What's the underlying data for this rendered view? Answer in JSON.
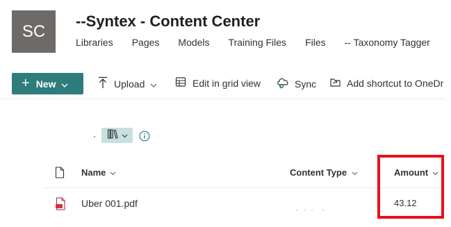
{
  "site": {
    "logo_initials": "SC",
    "title": "--Syntex - Content Center",
    "nav": [
      "Libraries",
      "Pages",
      "Models",
      "Training Files",
      "Files",
      "-- Taxonomy Tagger"
    ]
  },
  "commandbar": {
    "new_label": "New",
    "upload_label": "Upload",
    "grid_label": "Edit in grid view",
    "sync_label": "Sync",
    "shortcut_label": "Add shortcut to OneDr"
  },
  "list": {
    "columns": {
      "name": "Name",
      "content_type": "Content Type",
      "amount": "Amount"
    },
    "rows": [
      {
        "name": "Uber 001.pdf",
        "amount": "43.12"
      }
    ]
  },
  "colors": {
    "accent": "#2f7c7d",
    "highlight": "#e8101b",
    "pdf": "#d13438"
  }
}
